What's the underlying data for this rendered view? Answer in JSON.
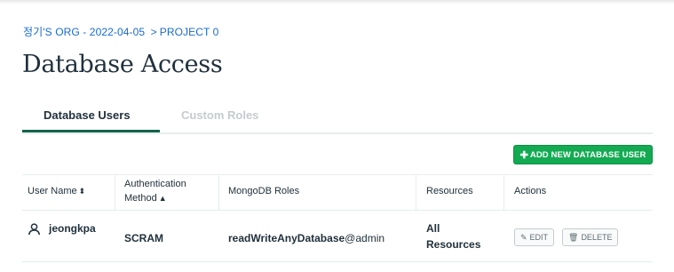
{
  "breadcrumb": {
    "org": "정기'S ORG - 2022-04-05",
    "separator": ">",
    "project": "PROJECT 0"
  },
  "page_title": "Database Access",
  "tabs": [
    {
      "label": "Database Users",
      "active": true
    },
    {
      "label": "Custom Roles",
      "active": false
    }
  ],
  "add_button": {
    "icon": "plus-icon",
    "label": "ADD NEW DATABASE USER"
  },
  "table": {
    "headers": {
      "user_name": "User Name",
      "auth_method_line1": "Authentication",
      "auth_method_line2": "Method",
      "roles": "MongoDB Roles",
      "resources": "Resources",
      "actions": "Actions"
    },
    "rows": [
      {
        "user": "jeongkpa",
        "auth_method": "SCRAM",
        "role": "readWriteAnyDatabase",
        "role_db": "@admin",
        "resources_line1": "All",
        "resources_line2": "Resources",
        "edit_label": "EDIT",
        "delete_label": "DELETE"
      }
    ]
  },
  "colors": {
    "accent_green": "#13aa52",
    "tab_underline": "#13644a",
    "breadcrumb_blue": "#1a6ad3"
  }
}
